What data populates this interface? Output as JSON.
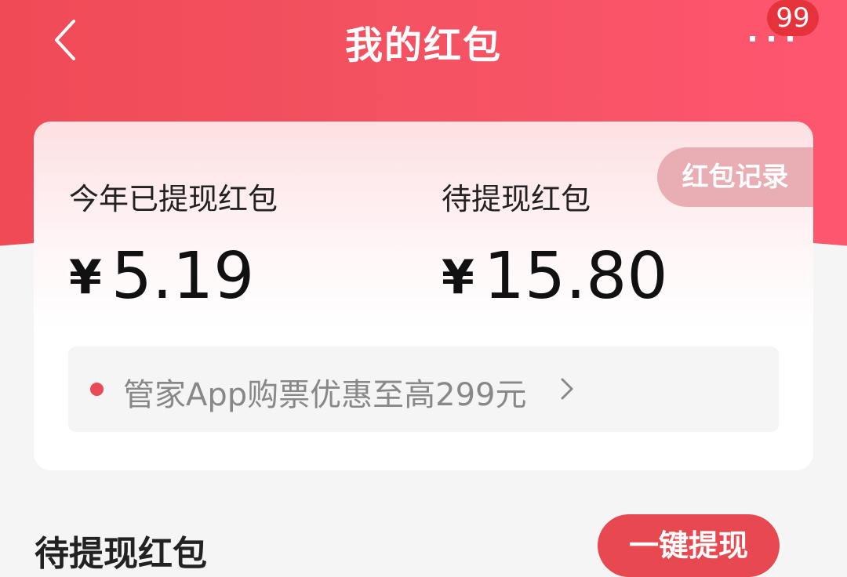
{
  "header": {
    "title": "我的红包",
    "badge_count": "99",
    "accent_color": "#f24c5a"
  },
  "card": {
    "record_button_label": "红包记录",
    "withdrawn": {
      "label": "今年已提现红包",
      "currency": "¥",
      "amount": "5.19"
    },
    "pending": {
      "label": "待提现红包",
      "currency": "¥",
      "amount": "15.80"
    },
    "promo": {
      "text": "管家App购票优惠至高299元"
    }
  },
  "section": {
    "title": "待提现红包",
    "withdraw_button_label": "一键提现"
  },
  "icons": {
    "back": "chevron-left-icon",
    "more": "more-dots-icon",
    "promo_arrow": "chevron-right-icon"
  }
}
